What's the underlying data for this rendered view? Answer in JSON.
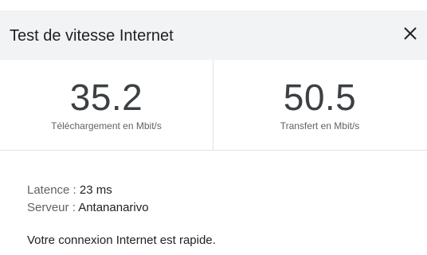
{
  "header": {
    "title": "Test de vitesse Internet",
    "close_icon": "close-icon"
  },
  "download": {
    "value": "35.2",
    "label": "Téléchargement en Mbit/s"
  },
  "upload": {
    "value": "50.5",
    "label": "Transfert en Mbit/s"
  },
  "latency": {
    "label": "Latence : ",
    "value": "23 ms"
  },
  "server": {
    "label": "Serveur : ",
    "value": "Antananarivo"
  },
  "summary": "Votre connexion Internet est rapide."
}
